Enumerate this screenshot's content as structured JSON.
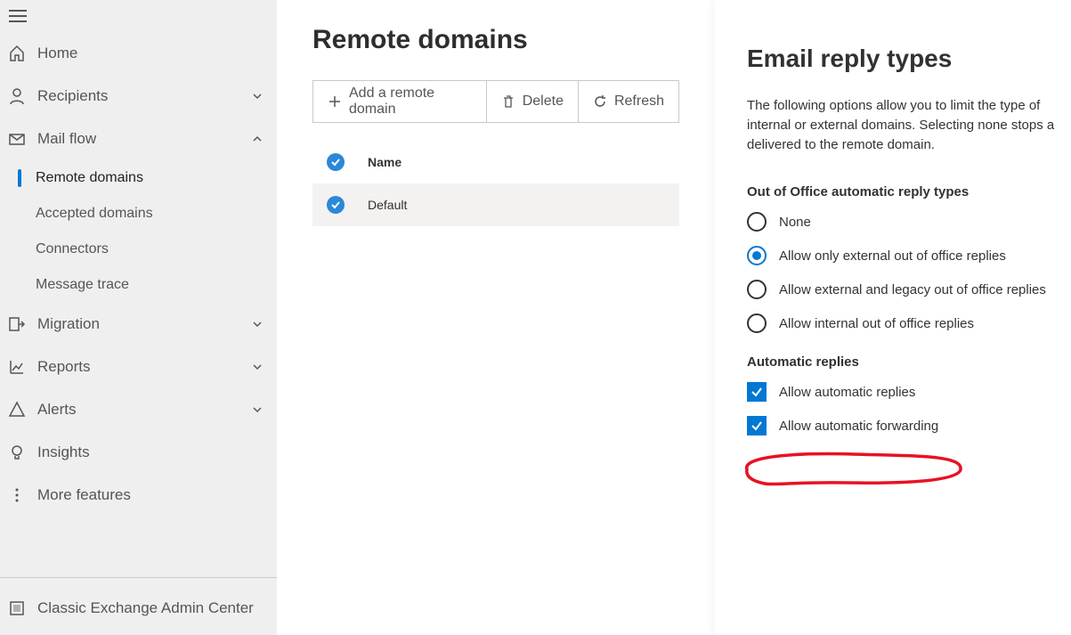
{
  "sidebar": {
    "items": [
      {
        "icon": "home",
        "label": "Home",
        "expandable": false
      },
      {
        "icon": "person",
        "label": "Recipients",
        "expandable": true,
        "expanded": false
      },
      {
        "icon": "mail",
        "label": "Mail flow",
        "expandable": true,
        "expanded": true,
        "children": [
          {
            "label": "Remote domains",
            "active": true
          },
          {
            "label": "Accepted domains",
            "active": false
          },
          {
            "label": "Connectors",
            "active": false
          },
          {
            "label": "Message trace",
            "active": false
          }
        ]
      },
      {
        "icon": "migrate",
        "label": "Migration",
        "expandable": true,
        "expanded": false
      },
      {
        "icon": "reports",
        "label": "Reports",
        "expandable": true,
        "expanded": false
      },
      {
        "icon": "alert",
        "label": "Alerts",
        "expandable": true,
        "expanded": false
      },
      {
        "icon": "bulb",
        "label": "Insights",
        "expandable": false
      },
      {
        "icon": "dots",
        "label": "More features",
        "expandable": false
      }
    ],
    "footer": {
      "icon": "classic",
      "label": "Classic Exchange Admin Center"
    }
  },
  "main": {
    "title": "Remote domains",
    "toolbar": {
      "add": "Add a remote domain",
      "delete": "Delete",
      "refresh": "Refresh"
    },
    "columns": {
      "name": "Name"
    },
    "rows": [
      {
        "selected": true,
        "name": "Default"
      }
    ]
  },
  "panel": {
    "title": "Email reply types",
    "description": "The following options allow you to limit the type of internal or external domains. Selecting none stops a delivered to the remote domain.",
    "section1_title": "Out of Office automatic reply types",
    "radios": [
      {
        "label": "None",
        "selected": false
      },
      {
        "label": "Allow only external out of office replies",
        "selected": true
      },
      {
        "label": "Allow external and legacy out of office replies",
        "selected": false
      },
      {
        "label": "Allow internal out of office replies",
        "selected": false
      }
    ],
    "section2_title": "Automatic replies",
    "checks": [
      {
        "label": "Allow automatic replies",
        "checked": true
      },
      {
        "label": "Allow automatic forwarding",
        "checked": true,
        "highlighted": true
      }
    ]
  }
}
